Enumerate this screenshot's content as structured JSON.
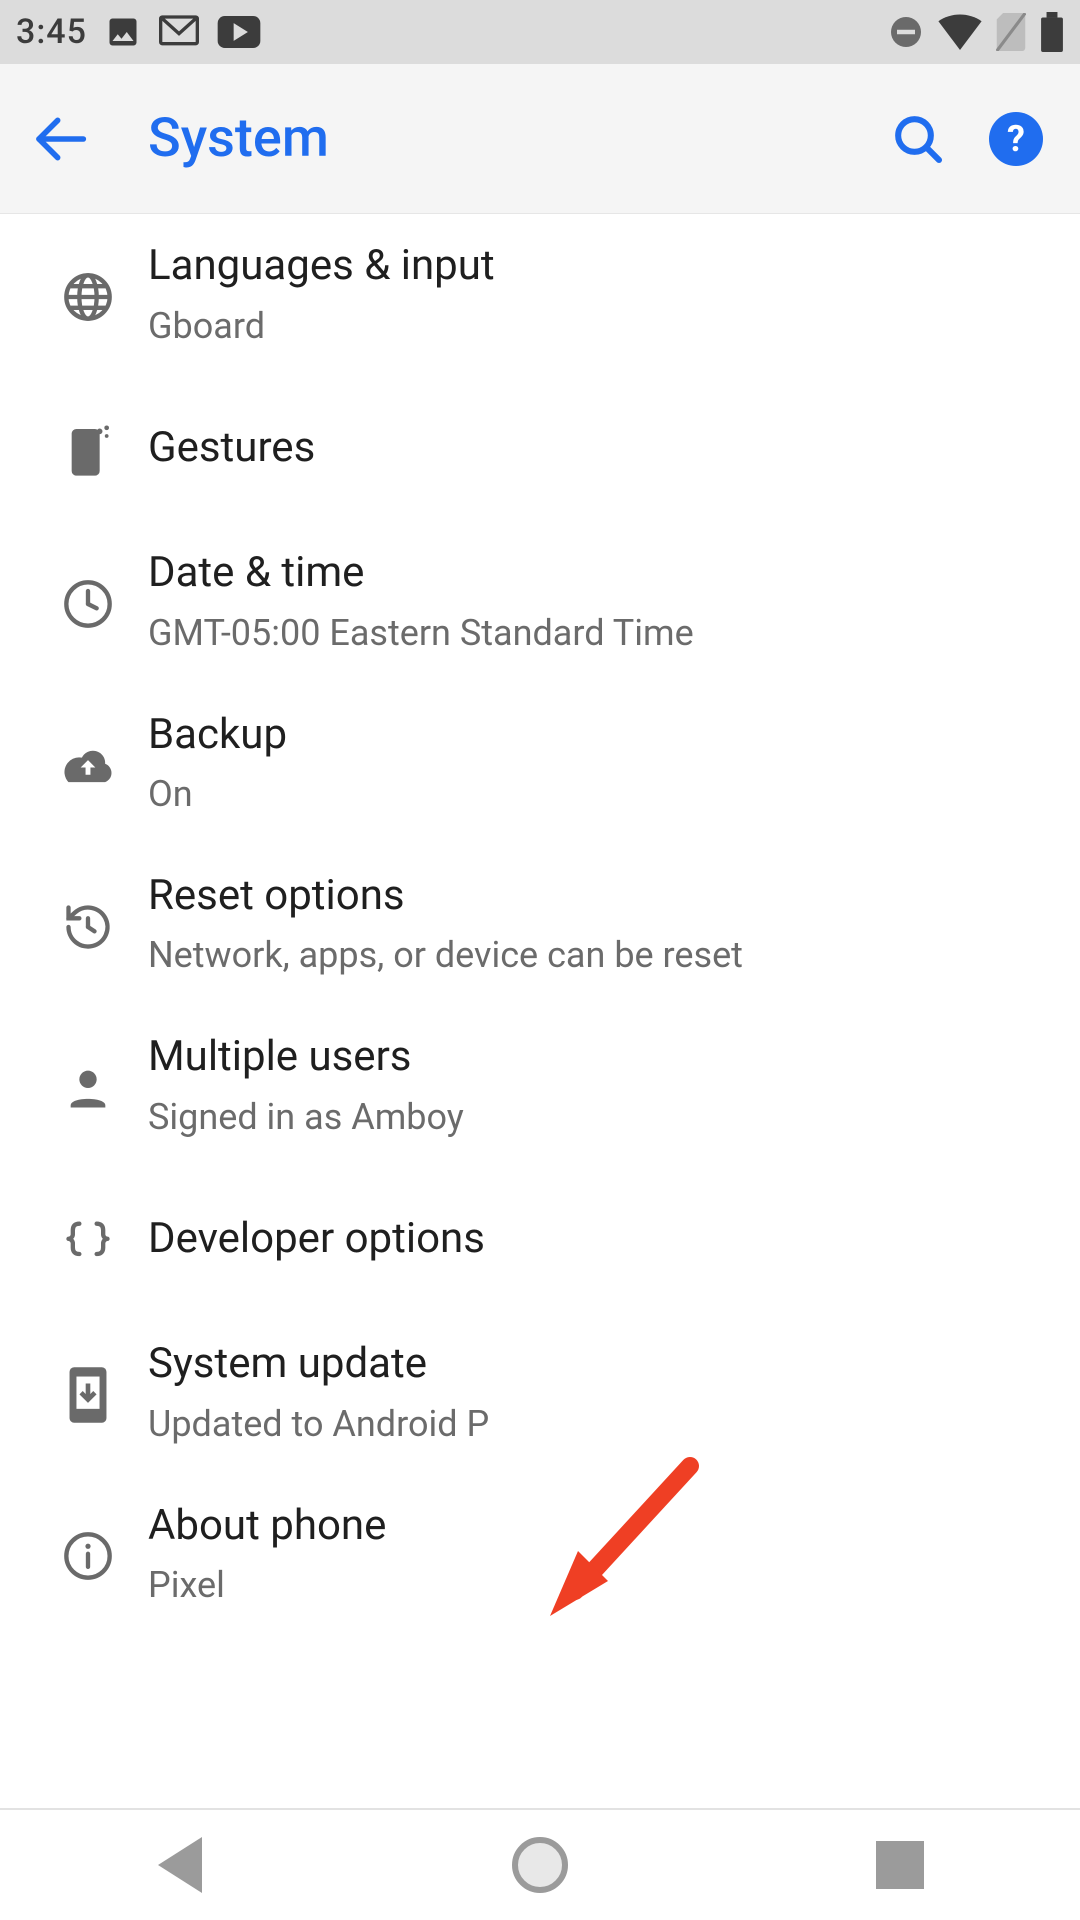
{
  "status": {
    "time": "3:45"
  },
  "appbar": {
    "title": "System"
  },
  "items": [
    {
      "id": "languages",
      "title": "Languages & input",
      "sub": "Gboard",
      "icon": "globe-icon"
    },
    {
      "id": "gestures",
      "title": "Gestures",
      "sub": "",
      "icon": "gesture-icon"
    },
    {
      "id": "datetime",
      "title": "Date & time",
      "sub": "GMT-05:00 Eastern Standard Time",
      "icon": "clock-icon"
    },
    {
      "id": "backup",
      "title": "Backup",
      "sub": "On",
      "icon": "cloud-upload-icon"
    },
    {
      "id": "reset",
      "title": "Reset options",
      "sub": "Network, apps, or device can be reset",
      "icon": "restore-icon"
    },
    {
      "id": "users",
      "title": "Multiple users",
      "sub": "Signed in as Amboy",
      "icon": "person-icon"
    },
    {
      "id": "developer",
      "title": "Developer options",
      "sub": "",
      "icon": "braces-icon"
    },
    {
      "id": "update",
      "title": "System update",
      "sub": "Updated to Android P",
      "icon": "system-update-icon"
    },
    {
      "id": "about",
      "title": "About phone",
      "sub": "Pixel",
      "icon": "info-icon"
    }
  ],
  "annotation": {
    "points_to": "developer"
  },
  "colors": {
    "accent": "#206def",
    "annotation": "#ef3f24"
  }
}
